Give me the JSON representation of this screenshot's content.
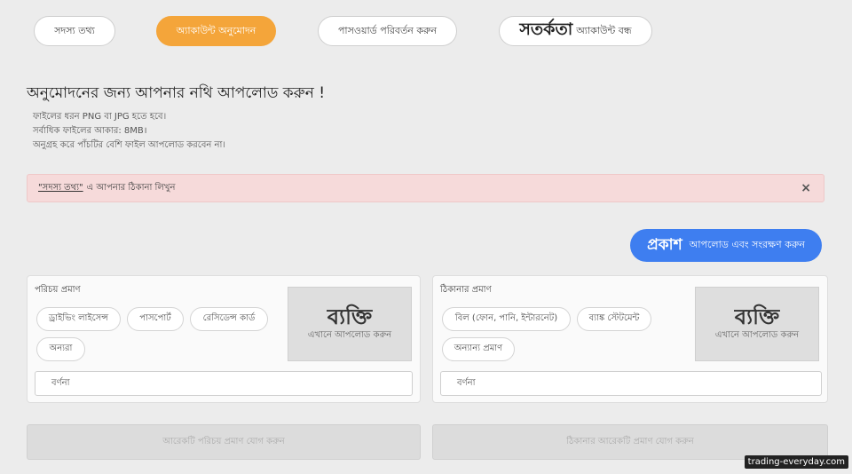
{
  "tabs": [
    {
      "label": "সদস্য তথ্য"
    },
    {
      "label": "অ্যাকাউন্ট অনুমোদন",
      "active": true
    },
    {
      "label": "পাসওয়ার্ড পরিবর্তন করুন"
    },
    {
      "big": "সতর্কতা",
      "label": "অ্যাকাউন্ট বন্ধ"
    }
  ],
  "heading": "অনুমোদনের জন্য আপনার নথি আপলোড করুন !",
  "rules": [
    "ফাইলের ধরন PNG বা JPG হতে হবে।",
    "সর্বাধিক ফাইলের আকার: 8MB।",
    "অনুগ্রহ করে পাঁচটির বেশি ফাইল আপলোড করবেন না।"
  ],
  "alert": {
    "link": "\"সদস্য তথ্য\"",
    "text": "এ আপনার ঠিকানা লিখুন",
    "close": "×"
  },
  "save_button": {
    "big": "প্রকাশ",
    "label": "আপলোড এবং সংরক্ষণ করুন"
  },
  "identity_card": {
    "title": "পরিচয় প্রমাণ",
    "options": [
      "ড্রাইভিং লাইসেন্স",
      "পাসপোর্ট",
      "রেসিডেন্স কার্ড",
      "অন্যরা"
    ],
    "upload_big": "ব্যক্তি",
    "upload_label": "এখানে আপলোড করুন",
    "description": "বর্ণনা"
  },
  "address_card": {
    "title": "ঠিকানার প্রমাণ",
    "options": [
      "বিল (ফোন, পানি, ইন্টারনেট)",
      "ব্যাঙ্ক স্টেটমেন্ট",
      "অন্যান্য প্রমাণ"
    ],
    "upload_big": "ব্যক্তি",
    "upload_label": "এখানে আপলোড করুন",
    "description": "বর্ণনা"
  },
  "add_identity_button": "আরেকটি পরিচয় প্রমাণ যোগ করুন",
  "add_address_button": "ঠিকানার আরেকটি প্রমাণ যোগ করুন",
  "watermark": "trading-everyday.com",
  "colors": {
    "accent": "#f4a53a",
    "primary_button": "#3e7ef0",
    "alert_bg": "#f6dada"
  }
}
